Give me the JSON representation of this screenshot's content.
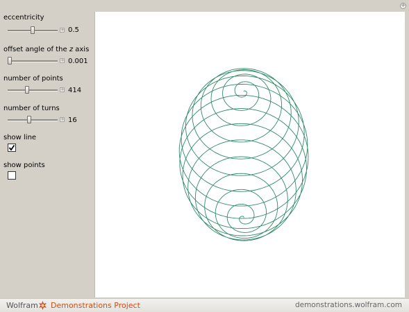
{
  "controls": {
    "eccentricity": {
      "label": "eccentricity",
      "value": "0.5",
      "slider_fraction": 0.5
    },
    "offset_angle": {
      "label_before": "offset angle of the ",
      "label_var": "z",
      "label_after": " axis",
      "value": "0.001",
      "slider_fraction": 0.0
    },
    "num_points": {
      "label": "number of points",
      "value": "414",
      "slider_fraction": 0.38
    },
    "num_turns": {
      "label": "number of turns",
      "value": "16",
      "slider_fraction": 0.42
    },
    "show_line": {
      "label": "show line",
      "checked": true
    },
    "show_points": {
      "label": "show points",
      "checked": false
    }
  },
  "plot": {
    "curve_color": "#2e8a68"
  },
  "footer": {
    "wolfram": "Wolfram",
    "project": "Demonstrations Project",
    "site": "demonstrations.wolfram.com",
    "project_color": "#c8501c"
  },
  "icons": {
    "expand": "plus-circle-icon",
    "brand": "spikey-icon",
    "slider_plus": "plus-icon",
    "check": "checkmark-icon"
  }
}
